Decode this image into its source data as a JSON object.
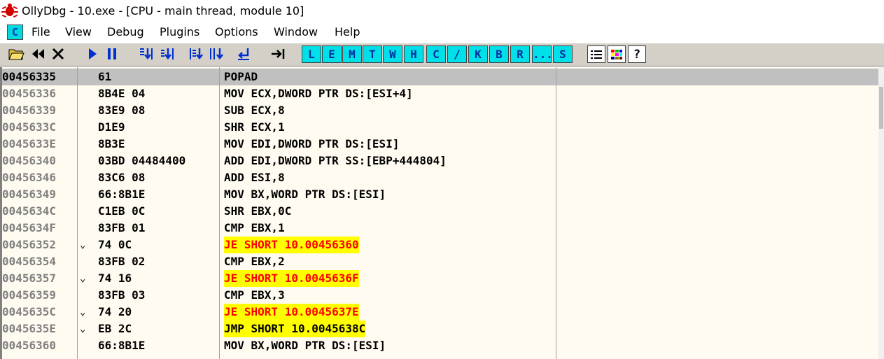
{
  "window": {
    "title": "OllyDbg - 10.exe - [CPU - main thread, module 10]"
  },
  "colors": {
    "toolbar_bg": "#d4d0c8",
    "pane_bg": "#fffbf0",
    "selected_row": "#c0c0c0",
    "jump_highlight": "#ffff00",
    "cond_jump_text": "#ff0000",
    "letter_button_bg": "#00e0e8"
  },
  "menu": {
    "icon_label": "C",
    "items": [
      "File",
      "View",
      "Debug",
      "Plugins",
      "Options",
      "Window",
      "Help"
    ]
  },
  "toolbar": {
    "icons": [
      "open-icon",
      "restart-icon",
      "close-icon",
      "run-icon",
      "pause-icon",
      "step-into-icon",
      "step-over-icon",
      "trace-into-icon",
      "trace-over-icon",
      "execute-till-return-icon",
      "goto-icon"
    ],
    "letters": [
      "L",
      "E",
      "M",
      "T",
      "W",
      "H",
      "C",
      "/",
      "K",
      "B",
      "R",
      "...",
      "S"
    ],
    "right_icons": [
      "list-icon",
      "colors-icon",
      "help-icon"
    ],
    "help_label": "?"
  },
  "rows": [
    {
      "addr": "00456335",
      "arrow": "",
      "hex": "61",
      "asm": "POPAD",
      "style": "normal",
      "selected": true
    },
    {
      "addr": "00456336",
      "arrow": "",
      "hex": "8B4E 04",
      "asm": "MOV ECX,DWORD PTR DS:[ESI+4]",
      "style": "normal"
    },
    {
      "addr": "00456339",
      "arrow": "",
      "hex": "83E9 08",
      "asm": "SUB ECX,8",
      "style": "normal"
    },
    {
      "addr": "0045633C",
      "arrow": "",
      "hex": "D1E9",
      "asm": "SHR ECX,1",
      "style": "normal"
    },
    {
      "addr": "0045633E",
      "arrow": "",
      "hex": "8B3E",
      "asm": "MOV EDI,DWORD PTR DS:[ESI]",
      "style": "normal"
    },
    {
      "addr": "00456340",
      "arrow": "",
      "hex": "03BD 04484400",
      "asm": "ADD EDI,DWORD PTR SS:[EBP+444804]",
      "style": "normal"
    },
    {
      "addr": "00456346",
      "arrow": "",
      "hex": "83C6 08",
      "asm": "ADD ESI,8",
      "style": "normal"
    },
    {
      "addr": "00456349",
      "arrow": "",
      "hex": "66:8B1E",
      "asm": "MOV BX,WORD PTR DS:[ESI]",
      "style": "normal"
    },
    {
      "addr": "0045634C",
      "arrow": "",
      "hex": "C1EB 0C",
      "asm": "SHR EBX,0C",
      "style": "normal"
    },
    {
      "addr": "0045634F",
      "arrow": "",
      "hex": "83FB 01",
      "asm": "CMP EBX,1",
      "style": "normal"
    },
    {
      "addr": "00456352",
      "arrow": "⌄",
      "hex": "74 0C",
      "asm": "JE SHORT 10.00456360",
      "style": "jcc"
    },
    {
      "addr": "00456354",
      "arrow": "",
      "hex": "83FB 02",
      "asm": "CMP EBX,2",
      "style": "normal"
    },
    {
      "addr": "00456357",
      "arrow": "⌄",
      "hex": "74 16",
      "asm": "JE SHORT 10.0045636F",
      "style": "jcc"
    },
    {
      "addr": "00456359",
      "arrow": "",
      "hex": "83FB 03",
      "asm": "CMP EBX,3",
      "style": "normal"
    },
    {
      "addr": "0045635C",
      "arrow": "⌄",
      "hex": "74 20",
      "asm": "JE SHORT 10.0045637E",
      "style": "jcc"
    },
    {
      "addr": "0045635E",
      "arrow": "⌄",
      "hex": "EB 2C",
      "asm": "JMP SHORT 10.0045638C",
      "style": "jmp"
    },
    {
      "addr": "00456360",
      "arrow": "",
      "hex": "66:8B1E",
      "asm": "MOV BX,WORD PTR DS:[ESI]",
      "style": "normal"
    }
  ]
}
